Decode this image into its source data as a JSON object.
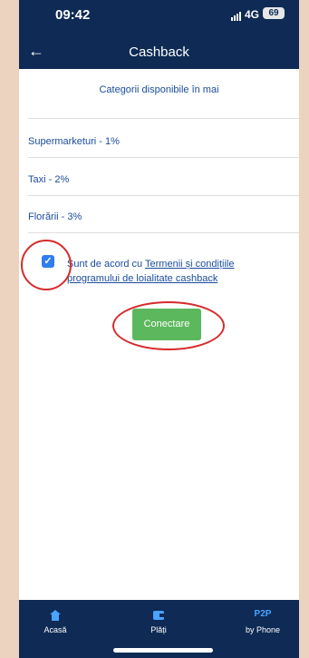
{
  "status_bar": {
    "time": "09:42",
    "network": "4G",
    "battery": "69"
  },
  "header": {
    "title": "Cashback"
  },
  "main": {
    "subtitle": "Categorii disponibile în mai",
    "categories": [
      "Supermarketuri - 1%",
      "Taxi - 2%",
      "Florării - 3%"
    ],
    "terms": {
      "prefix": "Sunt de acord cu ",
      "link": "Termenii și condițiile programului de loialitate cashback",
      "checked": true
    },
    "connect_button": "Conectare"
  },
  "tab_bar": {
    "items": [
      {
        "label": "Acasă",
        "icon": "home-icon"
      },
      {
        "label": "Plăți",
        "icon": "wallet-icon"
      },
      {
        "label": "by Phone",
        "icon_text": "P2P"
      }
    ]
  },
  "colors": {
    "brand": "#0e2a55",
    "accent_text": "#1a4c9c",
    "button_green": "#5cb85c",
    "annotation_red": "#d62b2b"
  }
}
